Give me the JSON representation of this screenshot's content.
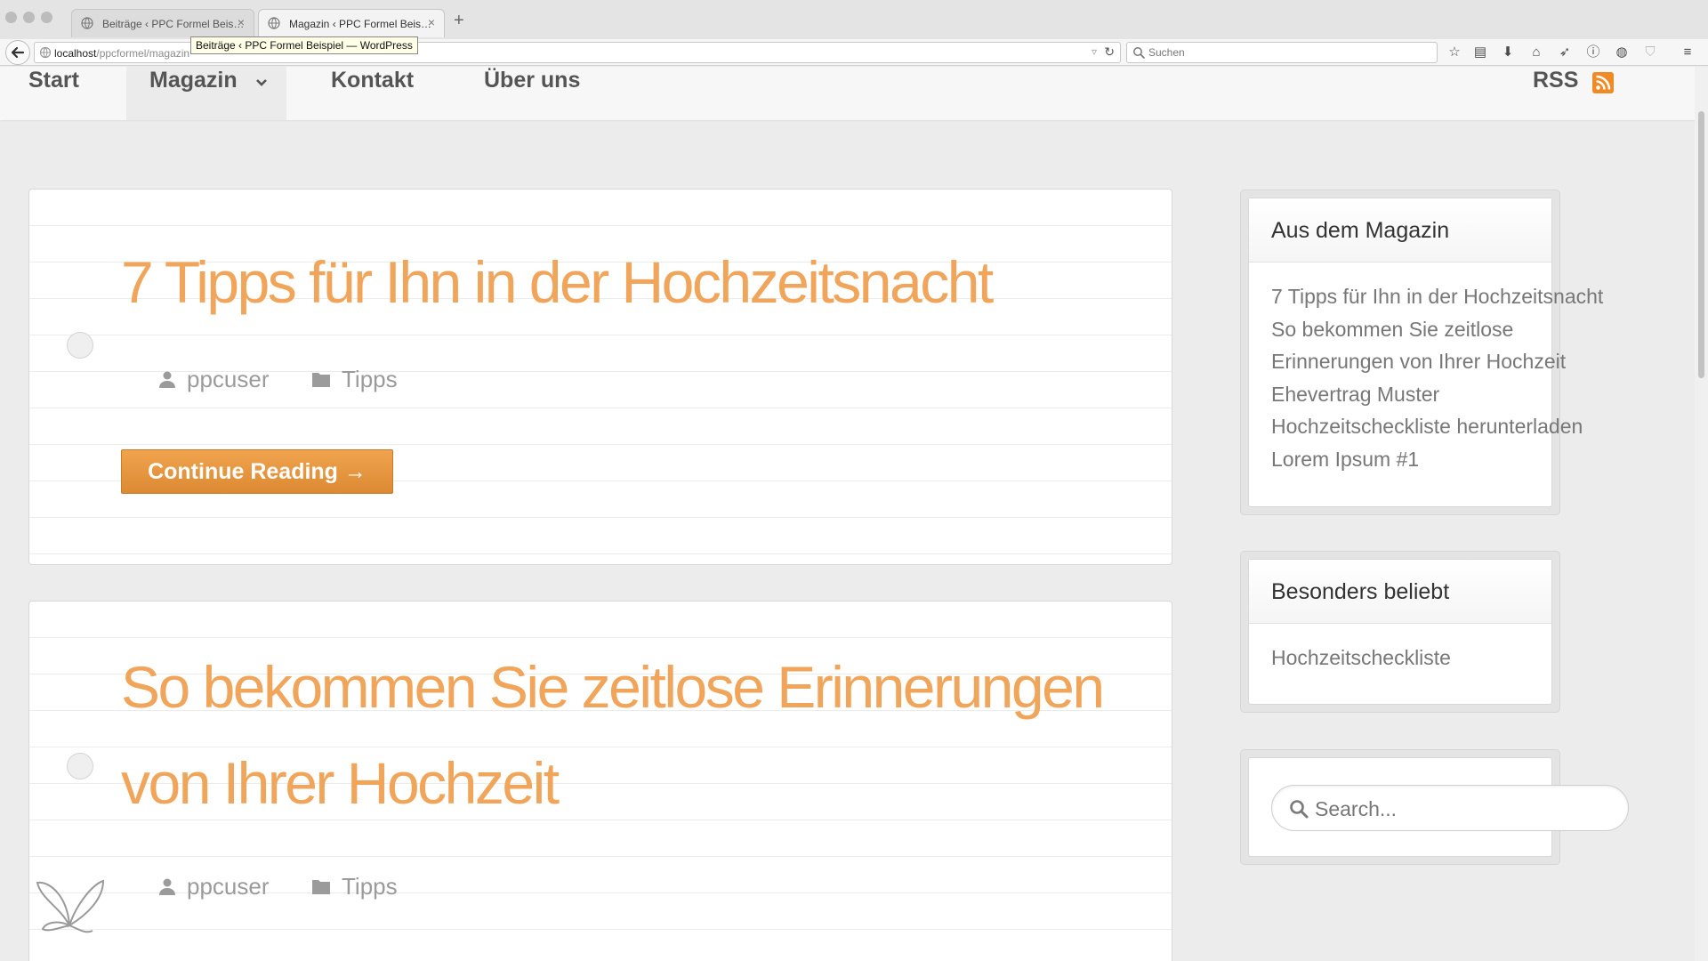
{
  "browser": {
    "tabs": [
      {
        "label": "Beiträge ‹ PPC Formel Beis…",
        "close": "×"
      },
      {
        "label": "Magazin ‹ PPC Formel Beis…",
        "close": "×"
      }
    ],
    "new_tab": "+",
    "tooltip": "Beiträge ‹ PPC Formel Beispiel — WordPress",
    "url_host": "localhost",
    "url_path": "/ppcformel/magazin",
    "search_placeholder": "Suchen"
  },
  "nav": {
    "items": [
      "Start",
      "Magazin",
      "Kontakt",
      "Über uns"
    ],
    "rss": "RSS",
    "accent_color": "#f08a24"
  },
  "posts": [
    {
      "title": "7 Tipps für Ihn in der Hochzeitsnacht",
      "author": "ppcuser",
      "category": "Tipps",
      "button": "Continue Reading →"
    },
    {
      "title_line1": "So bekommen Sie zeitlose Erinnerungen",
      "title_line2": "von Ihrer Hochzeit",
      "author": "ppcuser",
      "category": "Tipps"
    }
  ],
  "sidebar": {
    "magazin": {
      "title": "Aus dem Magazin",
      "items": [
        "7 Tipps für Ihn in der Hochzeitsnacht",
        "So bekommen Sie zeitlose",
        "Erinnerungen von Ihrer Hochzeit",
        "Ehevertrag Muster",
        "Hochzeitscheckliste herunterladen",
        "Lorem Ipsum #1"
      ]
    },
    "popular": {
      "title": "Besonders beliebt",
      "items": [
        "Hochzeitscheckliste"
      ]
    },
    "search": {
      "placeholder": "Search..."
    }
  },
  "colors": {
    "title_orange": "#f0a55a",
    "button_orange": "#e6963f"
  }
}
